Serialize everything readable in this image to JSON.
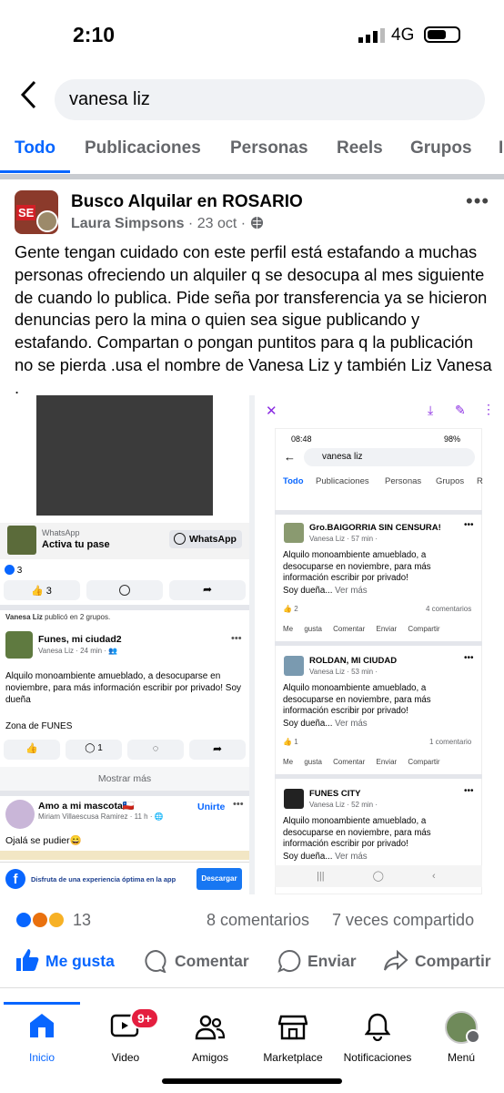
{
  "status": {
    "time": "2:10",
    "network": "4G"
  },
  "search": {
    "query": "vanesa liz"
  },
  "tabs": [
    "Todo",
    "Publicaciones",
    "Personas",
    "Reels",
    "Grupos",
    "I"
  ],
  "post": {
    "group": "Busco Alquilar en ROSARIO",
    "author": "Laura Simpsons",
    "date": "23 oct",
    "text": "Gente tengan cuidado con este perfil está estafando a muchas personas ofreciendo un alquiler q se desocupa al mes siguiente de cuando lo publica. Pide seña por transferencia ya se hicieron denuncias pero la mina o quien sea sigue publicando y estafando. Compartan o pongan puntitos para q la publicación no se pierda .usa el nombre de Vanesa Liz y también Liz Vanesa .",
    "reaction_count": "13",
    "comments": "8 comentarios",
    "shares": "7 veces compartido"
  },
  "left_shot": {
    "wa_small": "WhatsApp",
    "wa_big": "Activa tu pase",
    "wa_button": "WhatsApp",
    "likes": "3",
    "like_btn_count": "3",
    "shared_note_name": "Vanesa Liz",
    "shared_note": " publicó en 2 grupos.",
    "card1_group": "Funes, mi ciudad2",
    "card1_author": "Vanesa Liz",
    "card1_time": " · 24 min · ",
    "card1_text": "Alquilo monoambiente amueblado, a desocuparse en noviembre, para más información escribir por privado! Soy dueña",
    "card1_zone": "Zona de FUNES",
    "card1_comments": "1",
    "show_more": "Mostrar más",
    "card2_group": "Amo a mi mascota🇨🇱",
    "card2_join": "Unirte",
    "card2_author": "Miriam Villaescusa Ramirez",
    "card2_time": " · 11 h · ",
    "card2_text": "Ojalá se pudier😄",
    "banner": "Disfruta de una experiencia óptima en la app",
    "banner_btn": "Descargar"
  },
  "right_shot": {
    "time": "08:48",
    "battery": "98%",
    "search": "vanesa liz",
    "tabs": [
      "Todo",
      "Publicaciones",
      "Personas",
      "Grupos",
      "R"
    ],
    "cards": [
      {
        "group": "Gro.BAIGORRIA SIN CENSURA!",
        "author": "Vanesa Liz",
        "time": " · 57 min · ",
        "text": "Alquilo monoambiente amueblado, a desocuparse en noviembre, para más información escribir por privado!",
        "dots": "Soy dueña... ",
        "more": "Ver más",
        "likes": "2",
        "comments": "4 comentarios"
      },
      {
        "group": "ROLDAN, MI CIUDAD",
        "author": "Vanesa Liz",
        "time": " · 53 min · ",
        "text": "Alquilo monoambiente amueblado, a desocuparse en noviembre, para más información escribir por privado!",
        "dots": "Soy dueña... ",
        "more": "Ver más",
        "likes": "1",
        "comments": "1 comentario"
      },
      {
        "group": "FUNES CITY",
        "author": "Vanesa Liz",
        "time": " · 52 min · ",
        "text": "Alquilo monoambiente amueblado, a desocuparse en noviembre, para más información escribir por privado!",
        "dots": "Soy dueña... ",
        "more": "Ver más"
      }
    ],
    "actions": [
      "Me gusta",
      "Comentar",
      "Enviar",
      "Compartir"
    ]
  },
  "actions": {
    "like": "Me gusta",
    "comment": "Comentar",
    "send": "Enviar",
    "share": "Compartir"
  },
  "nav": {
    "home": "Inicio",
    "video": "Video",
    "video_badge": "9+",
    "friends": "Amigos",
    "marketplace": "Marketplace",
    "notifications": "Notificaciones",
    "menu": "Menú"
  },
  "colors": {
    "accent": "#0866ff",
    "whatsapp_badge": "#e41e3f"
  }
}
